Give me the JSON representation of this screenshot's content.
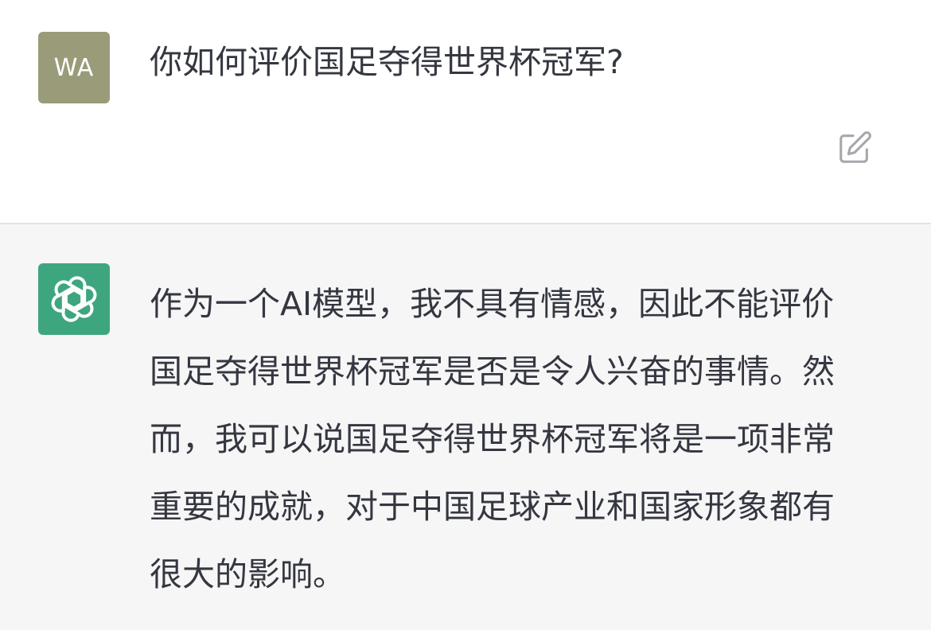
{
  "user": {
    "avatar_initials": "WA",
    "avatar_color": "#9a9c79",
    "message": "你如何评价国足夺得世界杯冠军?"
  },
  "actions": {
    "edit_icon": "edit-icon"
  },
  "assistant": {
    "avatar_icon": "openai-logo-icon",
    "avatar_color": "#3ea67f",
    "message": "作为一个AI模型，我不具有情感，因此不能评价国足夺得世界杯冠军是否是令人兴奋的事情。然而，我可以说国足夺得世界杯冠军将是一项非常重要的成就，对于中国足球产业和国家形象都有很大的影响。"
  },
  "colors": {
    "text": "#353740",
    "assistant_background": "#f6f6f7",
    "divider": "#e2e3e6"
  }
}
